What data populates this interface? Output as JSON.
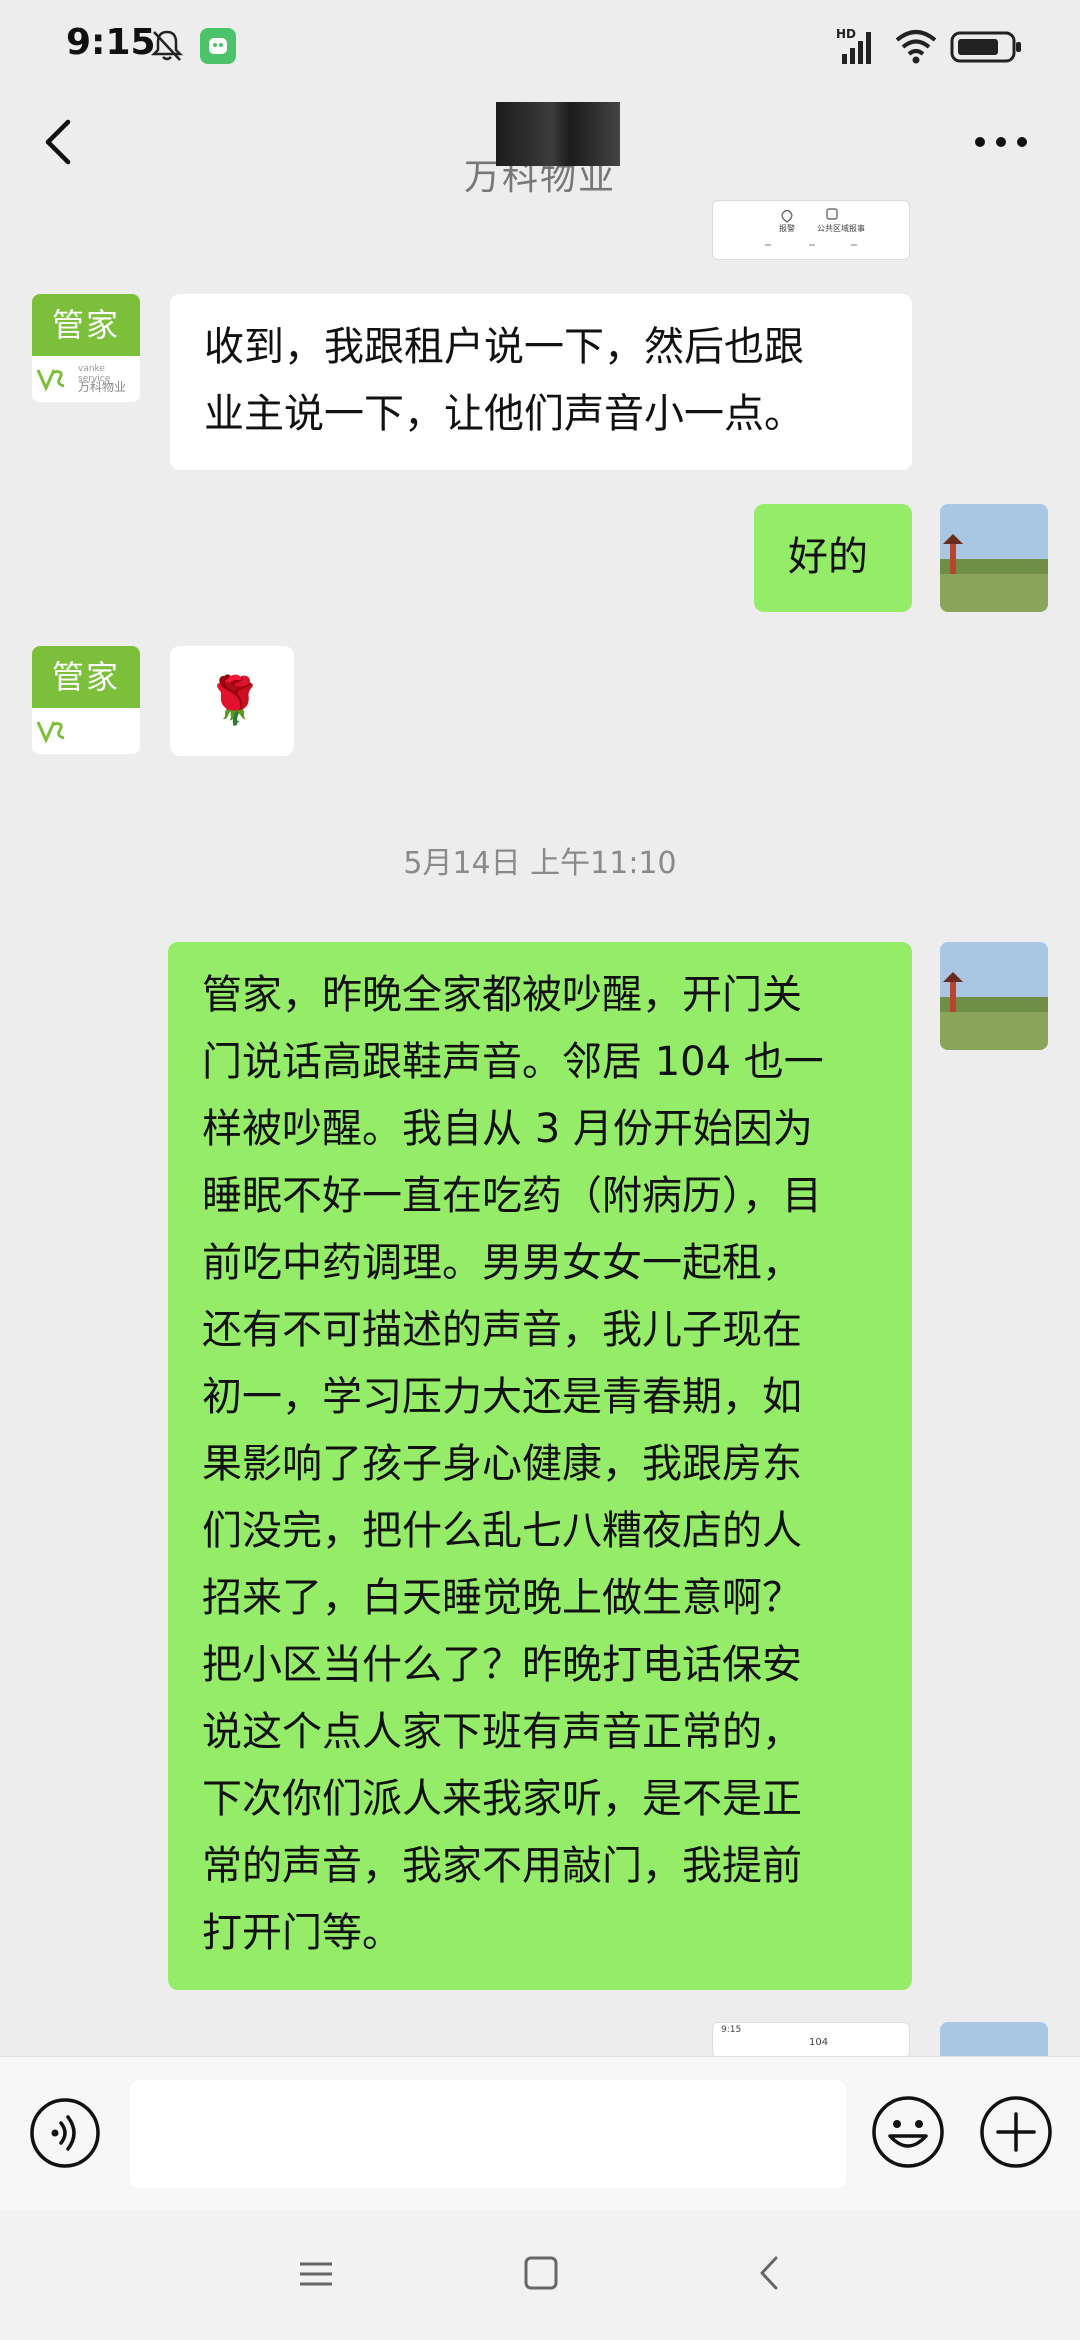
{
  "status_bar": {
    "time": "9:15",
    "icons": [
      "mute-bell-icon",
      "app-notification-icon",
      "hd-signal-icon",
      "wifi-icon",
      "battery-icon"
    ]
  },
  "nav": {
    "title": "万科物业",
    "back_icon": "chevron-left-icon",
    "more_icon": "more-dots-icon"
  },
  "agent_avatar": {
    "label": "管家",
    "brand_en": "vanke service",
    "brand_cn": "万科物业",
    "color": "#7cbf3a"
  },
  "messages": [
    {
      "sender": "agent",
      "text": "收到，我跟租户说一下，然后也跟\n业主说一下，让他们声音小一点。"
    },
    {
      "sender": "user",
      "text": "好的"
    },
    {
      "sender": "agent",
      "text": "🌹"
    },
    {
      "sender": "user",
      "text": "管家，昨晚全家都被吵醒，开门关\n门说话高跟鞋声音。邻居 104 也一\n样被吵醒。我自从 3 月份开始因为\n睡眠不好一直在吃药（附病历），目\n前吃中药调理。男男女女一起租，\n还有不可描述的声音，我儿子现在\n初一，学习压力大还是青春期，如\n果影响了孩子身心健康，我跟房东\n们没完，把什么乱七八糟夜店的人\n招来了，白天睡觉晚上做生意啊？\n把小区当什么了？昨晚打电话保安\n说这个点人家下班有声音正常的，\n下次你们派人来我家听，是不是正\n常的声音，我家不用敲门，我提前\n打开门等。"
    }
  ],
  "timestamp": "5月14日 上午11:10",
  "partial_screenshot": {
    "top_labels": [
      "报警",
      "公共区域报事"
    ],
    "bottom_time": "9:15",
    "bottom_label": "104"
  },
  "input_bar": {
    "placeholder": "",
    "voice_icon": "voice-icon",
    "emoji_icon": "emoji-icon",
    "plus_icon": "plus-icon"
  },
  "system_nav": {
    "icons": [
      "menu-icon",
      "home-icon",
      "back-icon"
    ]
  },
  "colors": {
    "background": "#ededed",
    "user_bubble": "#95ec69",
    "agent_bubble": "#ffffff",
    "accent": "#7cbf3a"
  }
}
